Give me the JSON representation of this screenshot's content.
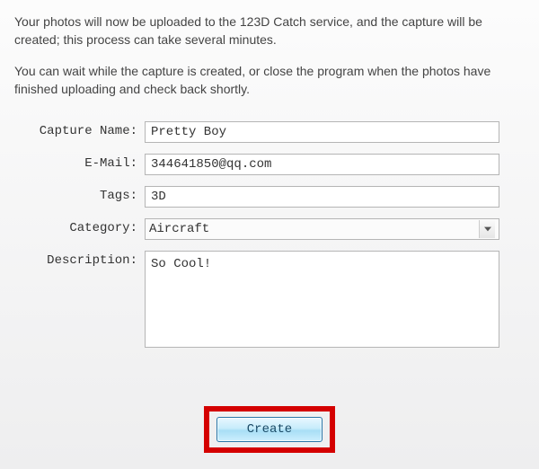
{
  "intro": {
    "p1": "Your photos will now be uploaded to the 123D Catch service, and the capture will be created; this process can take several minutes.",
    "p2": "You can wait while the capture is created, or close the program when the photos have finished uploading and check back shortly."
  },
  "form": {
    "capture_name": {
      "label": "Capture Name:",
      "value": "Pretty Boy"
    },
    "email": {
      "label": "E-Mail:",
      "value": "344641850@qq.com"
    },
    "tags": {
      "label": "Tags:",
      "value": "3D"
    },
    "category": {
      "label": "Category:",
      "value": "Aircraft"
    },
    "description": {
      "label": "Description:",
      "value": "So Cool!"
    }
  },
  "buttons": {
    "create": "Create"
  }
}
